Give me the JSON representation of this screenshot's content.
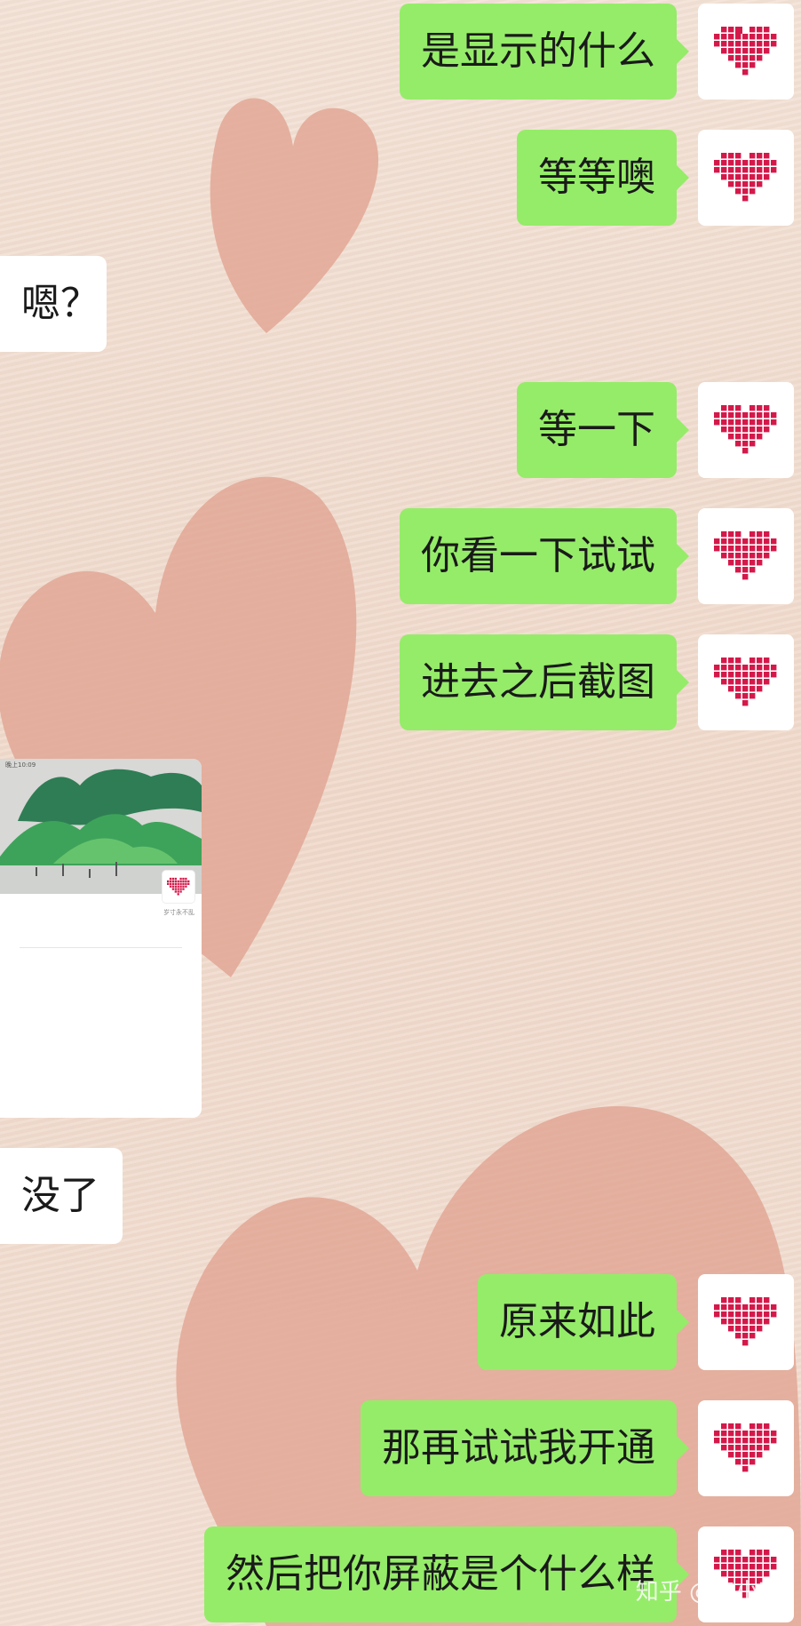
{
  "messages": [
    {
      "side": "out",
      "text": "是显示的什么"
    },
    {
      "side": "out",
      "text": "等等噢"
    },
    {
      "side": "in",
      "text": "嗯？"
    },
    {
      "side": "out",
      "text": "等一下"
    },
    {
      "side": "out",
      "text": "你看一下试试"
    },
    {
      "side": "out",
      "text": "进去之后截图"
    },
    {
      "side": "in",
      "type": "image"
    },
    {
      "side": "in",
      "text": "没了"
    },
    {
      "side": "out",
      "text": "原来如此"
    },
    {
      "side": "out",
      "text": "那再试试我开通"
    },
    {
      "side": "out",
      "text": "然后把你屏蔽是个什么样"
    }
  ],
  "avatar_icon": "pixel-heart-icon",
  "colors": {
    "outgoing_bubble": "#95ec69",
    "incoming_bubble": "#ffffff",
    "heart": "#d4194a",
    "background": "#f2ddd0"
  },
  "shared_image": {
    "status_time": "晚上10:09",
    "caption": "岁寸永不乱"
  },
  "watermark": "知乎 @韦小宛"
}
